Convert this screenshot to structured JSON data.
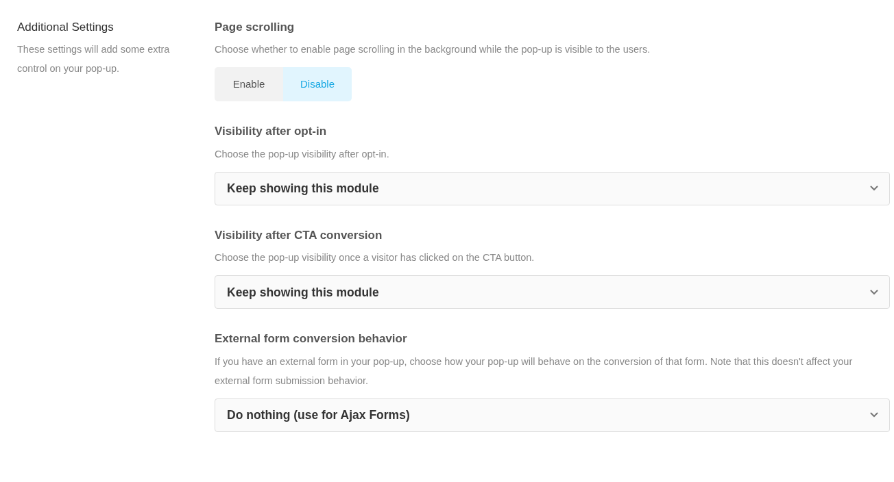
{
  "sidebar": {
    "title": "Additional Settings",
    "description": "These settings will add some extra control on your pop-up."
  },
  "sections": [
    {
      "kind": "toggle",
      "title": "Page scrolling",
      "description": "Choose whether to enable page scrolling in the background while the pop-up is visible to the users.",
      "options": [
        {
          "label": "Enable",
          "selected": false
        },
        {
          "label": "Disable",
          "selected": true
        }
      ]
    },
    {
      "kind": "select",
      "title": "Visibility after opt-in",
      "description": "Choose the pop-up visibility after opt-in.",
      "value": "Keep showing this module"
    },
    {
      "kind": "select",
      "title": "Visibility after CTA conversion",
      "description": "Choose the pop-up visibility once a visitor has clicked on the CTA button.",
      "value": "Keep showing this module"
    },
    {
      "kind": "select",
      "title": "External form conversion behavior",
      "description": "If you have an external form in your pop-up, choose how your pop-up will behave on the conversion of that form. Note that this doesn't affect your external form submission behavior.",
      "value": "Do nothing (use for Ajax Forms)"
    }
  ]
}
